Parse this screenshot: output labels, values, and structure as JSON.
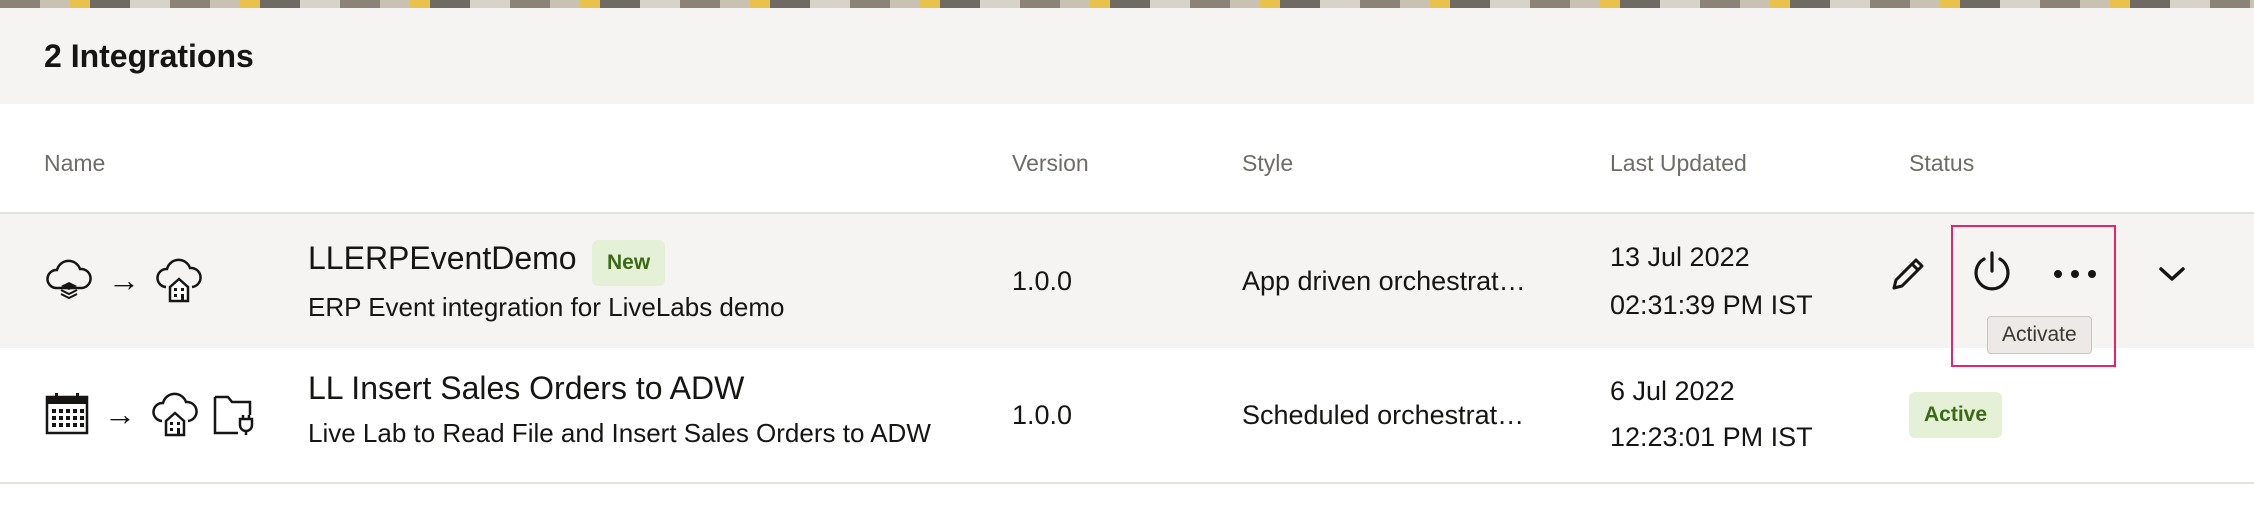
{
  "header": {
    "title": "2 Integrations"
  },
  "columns": {
    "name": "Name",
    "version": "Version",
    "style": "Style",
    "last_updated": "Last Updated",
    "status": "Status"
  },
  "rows": [
    {
      "name": "LLERPEventDemo",
      "badge": "New",
      "description": "ERP Event integration for LiveLabs demo",
      "version": "1.0.0",
      "style": "App driven orchestrat…",
      "date": "13 Jul 2022",
      "time": "02:31:39 PM IST",
      "icons": [
        "cloud-stack-icon",
        "arrow-right-icon",
        "cloud-building-icon"
      ]
    },
    {
      "name": "LL Insert Sales Orders to ADW",
      "description": "Live Lab to Read File and Insert Sales Orders to ADW",
      "version": "1.0.0",
      "style": "Scheduled orchestrat…",
      "date": "6 Jul 2022",
      "time": "12:23:01 PM IST",
      "status": "Active",
      "icons": [
        "calendar-icon",
        "arrow-right-icon",
        "cloud-building-icon",
        "folder-plug-icon"
      ]
    }
  ],
  "actions": {
    "tooltip": "Activate",
    "icons": [
      "pencil-icon",
      "power-icon",
      "more-icon",
      "chevron-down-icon"
    ]
  },
  "colors": {
    "highlight": "#e5246a",
    "badge_bg": "#e4f1d6",
    "badge_text": "#3b6a16",
    "row_hover": "#f5f4f2"
  }
}
